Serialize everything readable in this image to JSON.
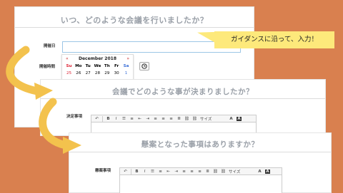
{
  "panel1": {
    "title": "いつ、どのような会議を行いましたか？",
    "date_label": "開催日",
    "time_label": "開催時間",
    "calendar": {
      "prev": "«",
      "next": "»",
      "month": "December 2018",
      "weekdays": [
        "Su",
        "Mo",
        "Tu",
        "We",
        "Th",
        "Fr",
        "Sa"
      ],
      "week1": [
        "25",
        "26",
        "27",
        "28",
        "29",
        "30",
        "1"
      ]
    },
    "clock_icon": "clock-icon"
  },
  "callout": {
    "text": "ガイダンスに沿って、入力！"
  },
  "panel2": {
    "title": "会議でどのような事が決まりましたか？",
    "field_label": "決定事項"
  },
  "panel3": {
    "title": "懸案となった事項はありますか？",
    "field_label": "懸案事項"
  },
  "toolbar": {
    "bold": "B",
    "italic": "I",
    "size_label": "サイズ",
    "font_color": "A",
    "bg_color": "A"
  },
  "colors": {
    "background": "#d9804f",
    "callout": "#fde97b",
    "arrow": "#f3c24d",
    "title": "#9aa0a8"
  }
}
